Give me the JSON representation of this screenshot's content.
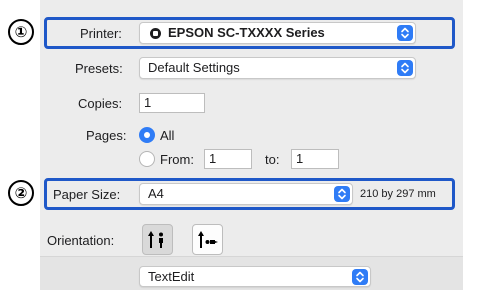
{
  "callouts": {
    "one": "①",
    "two": "②"
  },
  "printer": {
    "label": "Printer:",
    "value": "EPSON SC-TXXXX Series",
    "icon": "printer-status-icon"
  },
  "presets": {
    "label": "Presets:",
    "value": "Default Settings"
  },
  "copies": {
    "label": "Copies:",
    "value": "1"
  },
  "pages": {
    "label": "Pages:",
    "all_label": "All",
    "all_selected": true,
    "from_label": "From:",
    "from_value": "1",
    "to_label": "to:",
    "to_value": "1"
  },
  "paper_size": {
    "label": "Paper Size:",
    "value": "A4",
    "dimensions": "210 by 297 mm"
  },
  "orientation": {
    "label": "Orientation:",
    "options": [
      "portrait-icon",
      "landscape-icon"
    ],
    "selected": "portrait"
  },
  "section_popup": {
    "value": "TextEdit"
  },
  "colors": {
    "accent": "#2f7cf6",
    "highlight": "#1f58c8"
  }
}
